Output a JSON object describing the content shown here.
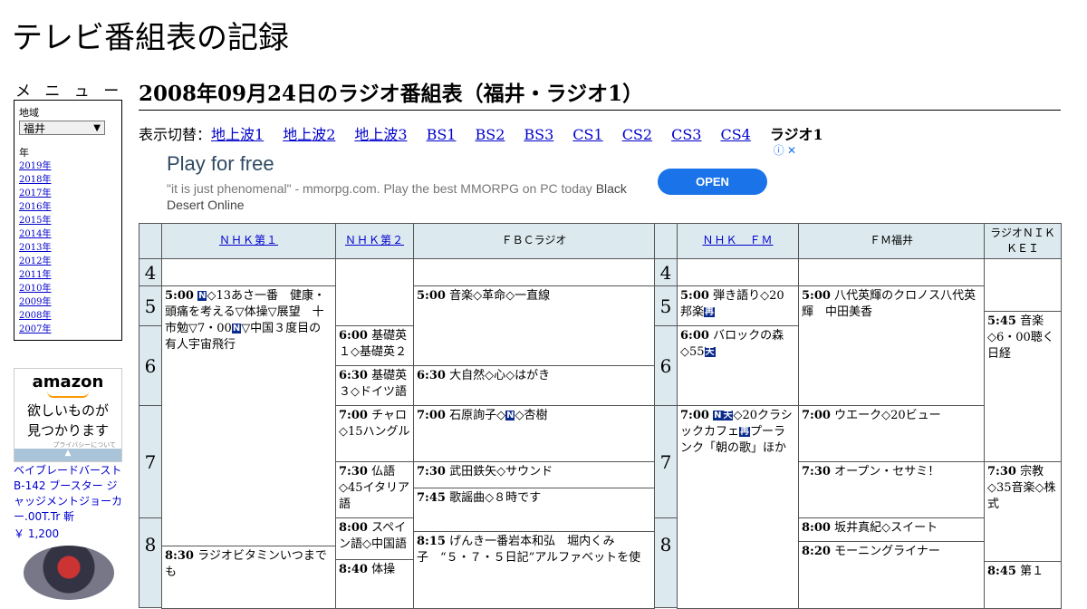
{
  "site_title": "テレビ番組表の記録",
  "sidebar": {
    "menu_heading": "メ ニ ュ ー",
    "region_label": "地域",
    "region_selected": "福井",
    "year_label": "年",
    "years": [
      "2019年",
      "2018年",
      "2017年",
      "2016年",
      "2015年",
      "2014年",
      "2013年",
      "2012年",
      "2011年",
      "2010年",
      "2009年",
      "2008年",
      "2007年"
    ]
  },
  "amazon_ad": {
    "logo": "amazon",
    "copy_line1": "欲しいものが",
    "copy_line2": "見つかります",
    "privacy": "プライバシーについて",
    "product_title": "ベイブレードバースト B-142 ブースター ジャッジメントジョーカー.00T.Tr 斬",
    "product_price": "￥ 1,200"
  },
  "page_heading": "2008年09月24日のラジオ番組表（福井・ラジオ1）",
  "switcher": {
    "label": "表示切替：",
    "links": [
      "地上波1",
      "地上波2",
      "地上波3",
      "BS1",
      "BS2",
      "BS3",
      "CS1",
      "CS2",
      "CS3",
      "CS4"
    ],
    "current": "ラジオ1"
  },
  "game_ad": {
    "headline": "Play for free",
    "body": "\"it is just phenomenal\" - mmorpg.com. Play the best MMORPG on PC today",
    "body_brand": "Black Desert Online",
    "cta": "OPEN",
    "adchoice": "ⓘ ✕"
  },
  "channels": {
    "nhk1": "ＮＨＫ第１",
    "nhk2": "ＮＨＫ第２",
    "fbc": "ＦＢＣラジオ",
    "nhkfm": "ＮＨＫ　ＦＭ",
    "fmfukui": "ＦＭ福井",
    "nikkei": "ラジオＮＩＫＫＥＩ"
  },
  "hours": [
    "4",
    "5",
    "6",
    "7",
    "8"
  ],
  "programs": {
    "nhk1_500": {
      "time": "5:00",
      "pre": "",
      "badge": "N",
      "post": "◇13あさ一番　健康・頭痛を考える▽体操▽展望　十市勉▽7・00",
      "badge2": "N",
      "post2": "▽中国３度目の有人宇宙飛行"
    },
    "nhk1_830": {
      "time": "8:30",
      "text": "ラジオビタミンいつまでも"
    },
    "nhk2_600": {
      "time": "6:00",
      "text": "基礎英１◇基礎英２"
    },
    "nhk2_630": {
      "time": "6:30",
      "text": "基礎英３◇ドイツ語"
    },
    "nhk2_700": {
      "time": "7:00",
      "text": "チャロ◇15ハングル"
    },
    "nhk2_730": {
      "time": "7:30",
      "text": "仏語◇45イタリア語"
    },
    "nhk2_800": {
      "time": "8:00",
      "text": "スペイン語◇中国語"
    },
    "nhk2_840": {
      "time": "8:40",
      "text": "体操"
    },
    "fbc_500": {
      "time": "5:00",
      "text": "音楽◇革命◇一直線"
    },
    "fbc_630": {
      "time": "6:30",
      "text": "大自然◇心◇はがき"
    },
    "fbc_700": {
      "time": "7:00",
      "pre": "石原詢子◇",
      "badge": "N",
      "post": "◇杏樹"
    },
    "fbc_730": {
      "time": "7:30",
      "text": "武田鉄矢◇サウンド"
    },
    "fbc_745": {
      "time": "7:45",
      "text": "歌謡曲◇８時です"
    },
    "fbc_815": {
      "time": "8:15",
      "text": "げんき一番岩本和弘　堀内くみ子　“５・７・５日記”アルファベットを使"
    },
    "fm_500": {
      "time": "5:00",
      "pre": "弾き語り◇20邦楽",
      "badge": "再",
      "post": ""
    },
    "fm_600": {
      "time": "6:00",
      "pre": "バロックの森◇55",
      "badge": "天",
      "post": ""
    },
    "fm_700": {
      "time": "7:00",
      "pre": "",
      "badge": "N",
      "mid": "天",
      "post": "◇20クラシックカフェ",
      "badge2": "再",
      "post2": "プーランク「朝の歌」ほか"
    },
    "fmf_500": {
      "time": "5:00",
      "text": "八代英輝のクロノス八代英輝　中田美香"
    },
    "fmf_700": {
      "time": "7:00",
      "text": "ウエーク◇20ビュー"
    },
    "fmf_730": {
      "time": "7:30",
      "text": "オープン・セサミ！"
    },
    "fmf_800": {
      "time": "8:00",
      "text": "坂井真紀◇スイート"
    },
    "fmf_820": {
      "time": "8:20",
      "text": "モーニングライナー"
    },
    "nk_545": {
      "time": "5:45",
      "text": "音楽◇6・00聴く日経"
    },
    "nk_730": {
      "time": "7:30",
      "text": "宗教◇35音楽◇株式"
    },
    "nk_845": {
      "time": "8:45",
      "text": "第１"
    }
  },
  "colors": {
    "header_bg": "#dceaf0",
    "link": "#0000cc",
    "badge": "#0a2a8c",
    "cta": "#1a73e8"
  }
}
